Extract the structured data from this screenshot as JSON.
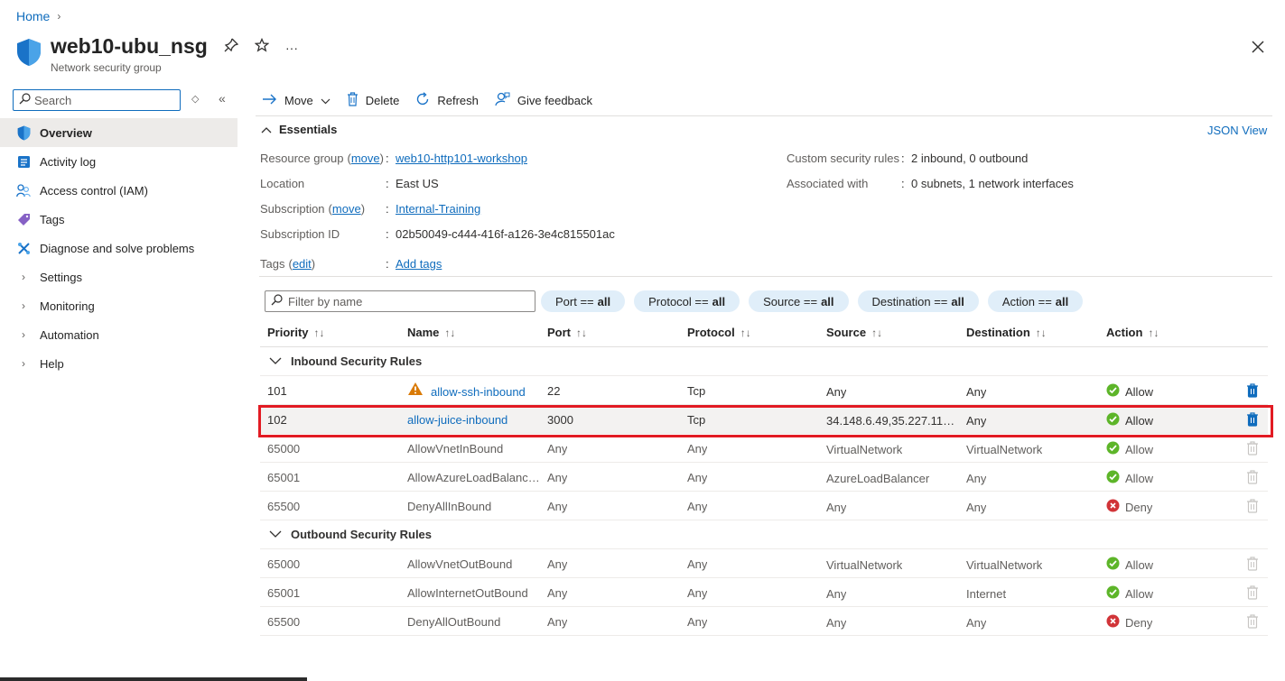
{
  "breadcrumb": {
    "home": "Home"
  },
  "header": {
    "title": "web10-ubu_nsg",
    "subtitle": "Network security group",
    "more": "···"
  },
  "sidebar": {
    "search_placeholder": "Search",
    "items": [
      {
        "label": "Overview",
        "icon": "shield-icon",
        "active": true
      },
      {
        "label": "Activity log",
        "icon": "activity-log-icon"
      },
      {
        "label": "Access control (IAM)",
        "icon": "people-icon"
      },
      {
        "label": "Tags",
        "icon": "tag-icon"
      },
      {
        "label": "Diagnose and solve problems",
        "icon": "wrench-icon"
      },
      {
        "label": "Settings",
        "icon": "chevron-right-icon"
      },
      {
        "label": "Monitoring",
        "icon": "chevron-right-icon"
      },
      {
        "label": "Automation",
        "icon": "chevron-right-icon"
      },
      {
        "label": "Help",
        "icon": "chevron-right-icon"
      }
    ]
  },
  "toolbar": {
    "move": "Move",
    "delete": "Delete",
    "refresh": "Refresh",
    "feedback": "Give feedback"
  },
  "essentials": {
    "heading": "Essentials",
    "json_view": "JSON View",
    "resource_group_label": "Resource group",
    "move_link": "move",
    "resource_group_value": "web10-http101-workshop",
    "location_label": "Location",
    "location_value": "East US",
    "subscription_label": "Subscription",
    "subscription_value": "Internal-Training",
    "subscription_id_label": "Subscription ID",
    "subscription_id_value": "02b50049-c444-416f-a126-3e4c815501ac",
    "tags_label": "Tags",
    "edit_link": "edit",
    "add_tags": "Add tags",
    "custom_rules_label": "Custom security rules",
    "custom_rules_value": "2 inbound, 0 outbound",
    "associated_label": "Associated with",
    "associated_value": "0 subnets, 1 network interfaces",
    "colon": ":"
  },
  "filters": {
    "placeholder": "Filter by name",
    "pills": [
      {
        "key": "Port ==",
        "value": "all"
      },
      {
        "key": "Protocol ==",
        "value": "all"
      },
      {
        "key": "Source ==",
        "value": "all"
      },
      {
        "key": "Destination ==",
        "value": "all"
      },
      {
        "key": "Action ==",
        "value": "all"
      }
    ]
  },
  "table": {
    "columns": [
      "Priority",
      "Name",
      "Port",
      "Protocol",
      "Source",
      "Destination",
      "Action"
    ],
    "inbound_group": "Inbound Security Rules",
    "outbound_group": "Outbound Security Rules",
    "inbound": [
      {
        "priority": "101",
        "name": "allow-ssh-inbound",
        "port": "22",
        "protocol": "Tcp",
        "source": "Any",
        "destination": "Any",
        "action": "Allow",
        "warning": true,
        "link": true
      },
      {
        "priority": "102",
        "name": "allow-juice-inbound",
        "port": "3000",
        "protocol": "Tcp",
        "source": "34.148.6.49,35.227.112.…",
        "destination": "Any",
        "action": "Allow",
        "link": true,
        "selected": true
      },
      {
        "priority": "65000",
        "name": "AllowVnetInBound",
        "port": "Any",
        "protocol": "Any",
        "source": "VirtualNetwork",
        "destination": "VirtualNetwork",
        "action": "Allow"
      },
      {
        "priority": "65001",
        "name": "AllowAzureLoadBalanc…",
        "port": "Any",
        "protocol": "Any",
        "source": "AzureLoadBalancer",
        "destination": "Any",
        "action": "Allow"
      },
      {
        "priority": "65500",
        "name": "DenyAllInBound",
        "port": "Any",
        "protocol": "Any",
        "source": "Any",
        "destination": "Any",
        "action": "Deny"
      }
    ],
    "outbound": [
      {
        "priority": "65000",
        "name": "AllowVnetOutBound",
        "port": "Any",
        "protocol": "Any",
        "source": "VirtualNetwork",
        "destination": "VirtualNetwork",
        "action": "Allow"
      },
      {
        "priority": "65001",
        "name": "AllowInternetOutBound",
        "port": "Any",
        "protocol": "Any",
        "source": "Any",
        "destination": "Internet",
        "action": "Allow"
      },
      {
        "priority": "65500",
        "name": "DenyAllOutBound",
        "port": "Any",
        "protocol": "Any",
        "source": "Any",
        "destination": "Any",
        "action": "Deny"
      }
    ]
  },
  "colors": {
    "accent": "#0f6cbd",
    "allow": "#5db529",
    "deny": "#d13438",
    "highlight": "#e21b23",
    "warning": "#d97a06"
  }
}
